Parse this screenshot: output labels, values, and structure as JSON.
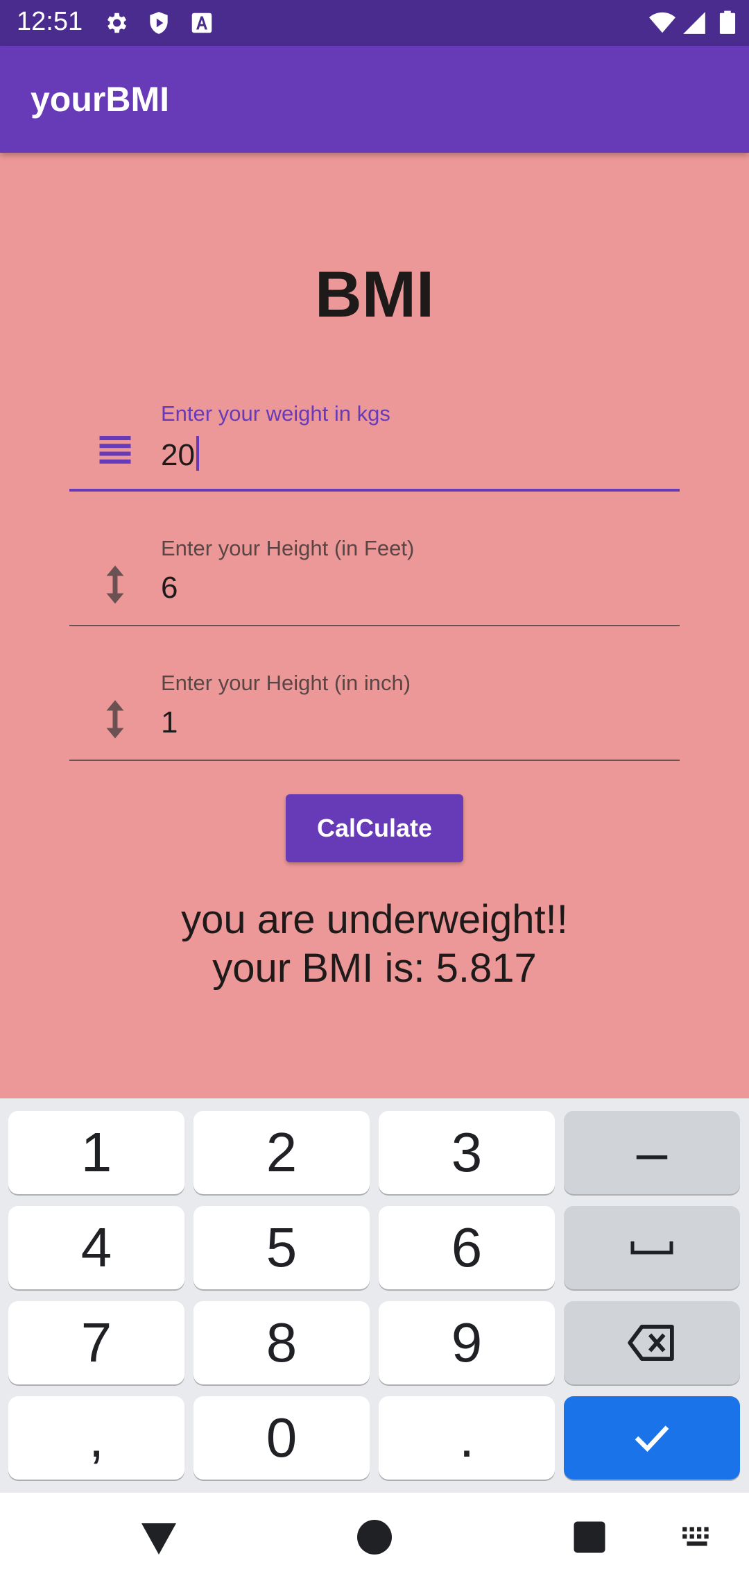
{
  "status_bar": {
    "time": "12:51",
    "icons": [
      "gear-icon",
      "play-protect-icon",
      "font-a-icon",
      "wifi-icon",
      "signal-icon",
      "battery-icon"
    ]
  },
  "app_bar": {
    "title": "yourBMI"
  },
  "main": {
    "heading": "BMI",
    "fields": [
      {
        "label": "Enter your weight in kgs",
        "value": "20",
        "icon": "weight-lines-icon",
        "focused": true
      },
      {
        "label": "Enter your Height (in Feet)",
        "value": "6",
        "icon": "vertical-arrows-icon",
        "focused": false
      },
      {
        "label": "Enter your Height (in inch)",
        "value": "1",
        "icon": "vertical-arrows-icon",
        "focused": false
      }
    ],
    "calculate_label": "CalCulate",
    "result_line1": "you are underweight!!",
    "result_line2": "your BMI is: 5.817"
  },
  "keyboard": {
    "rows": [
      [
        "1",
        "2",
        "3",
        "–"
      ],
      [
        "4",
        "5",
        "6",
        "space"
      ],
      [
        "7",
        "8",
        "9",
        "backspace"
      ],
      [
        ",",
        "0",
        ".",
        "done"
      ]
    ]
  },
  "colors": {
    "status_bar": "#4a2c8e",
    "app_bar": "#673ab7",
    "content_background": "#ed9898",
    "accent": "#673ab7",
    "keyboard_done": "#1a73e8"
  }
}
